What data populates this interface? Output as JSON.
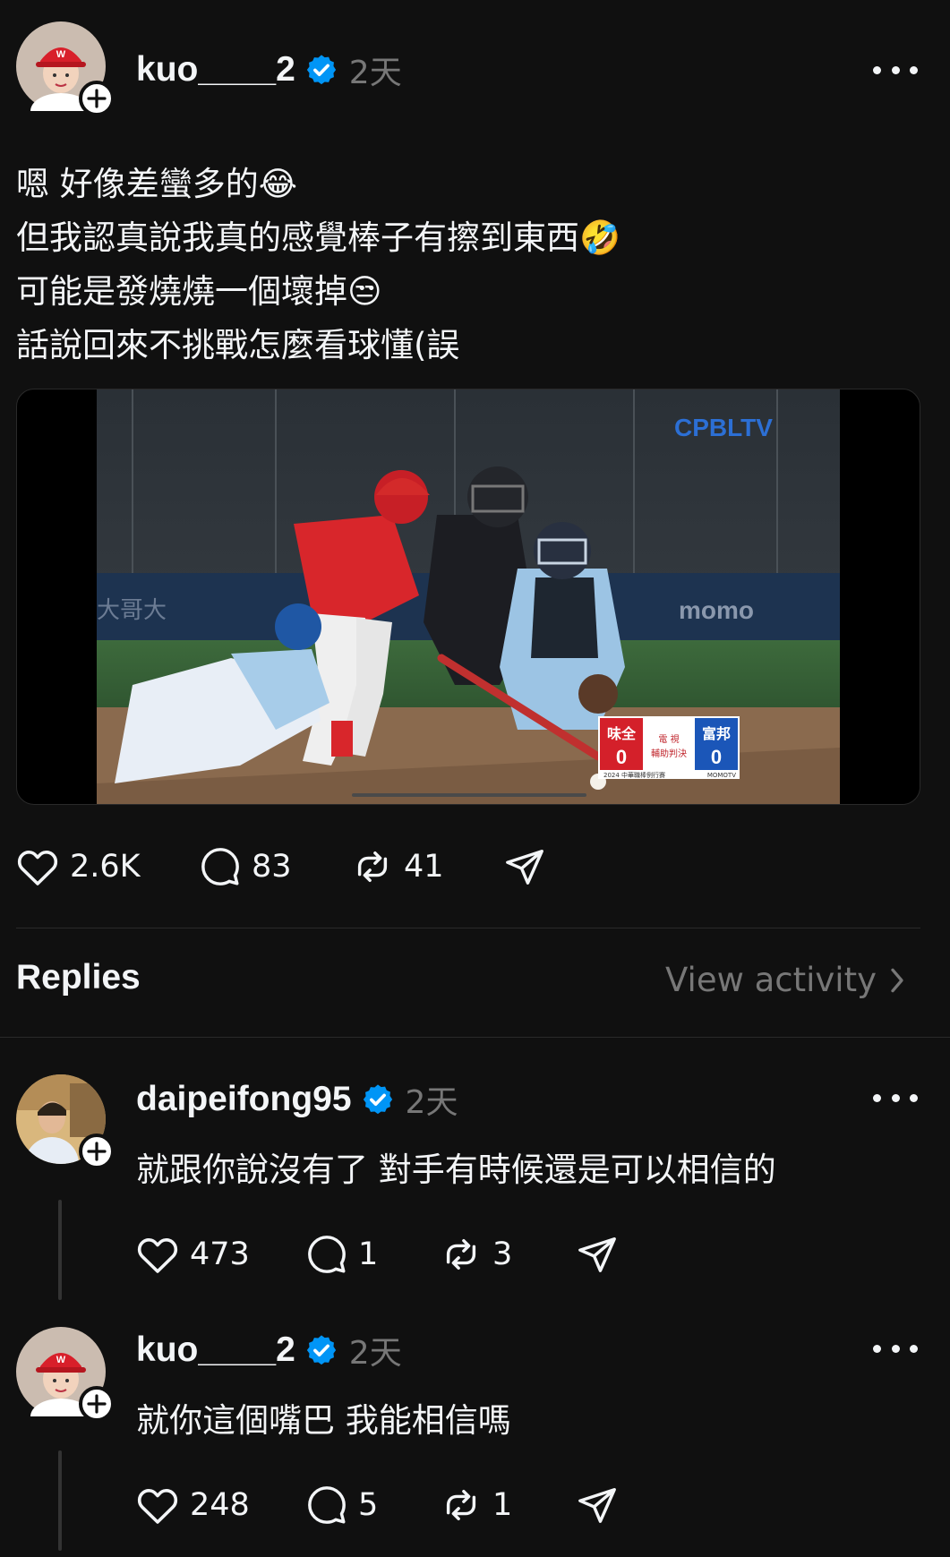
{
  "post": {
    "username": "kuo____2",
    "time": "2天",
    "lines": [
      "嗯 好像差蠻多的😂",
      "但我認真說我真的感覺棒子有擦到東西🤣",
      "可能是發燒燒一個壞掉😒",
      "話說回來不挑戰怎麼看球懂(誤"
    ],
    "media": {
      "logo": "CPBLTV",
      "ad_left": "大哥大",
      "ad_right": "momo",
      "score": {
        "team_left": "味全",
        "team_right": "富邦",
        "score_left": "0",
        "score_right": "0",
        "middle_top": "電 視",
        "middle_bottom": "輔助判決",
        "footer_left": "2024 中華職棒例行賽",
        "footer_right": "MOMOTV"
      }
    },
    "stats": {
      "likes": "2.6K",
      "comments": "83",
      "reposts": "41"
    }
  },
  "replies_header": {
    "title": "Replies",
    "view_activity": "View activity"
  },
  "replies": [
    {
      "username": "daipeifong95",
      "time": "2天",
      "text": "就跟你說沒有了 對手有時候還是可以相信的",
      "stats": {
        "likes": "473",
        "comments": "1",
        "reposts": "3"
      }
    },
    {
      "username": "kuo____2",
      "time": "2天",
      "text": "就你這個嘴巴 我能相信嗎",
      "stats": {
        "likes": "248",
        "comments": "5",
        "reposts": "1"
      }
    }
  ],
  "colors": {
    "background": "#101010",
    "text": "#f3f5f7",
    "muted": "#777777",
    "verified": "#0095f6"
  }
}
